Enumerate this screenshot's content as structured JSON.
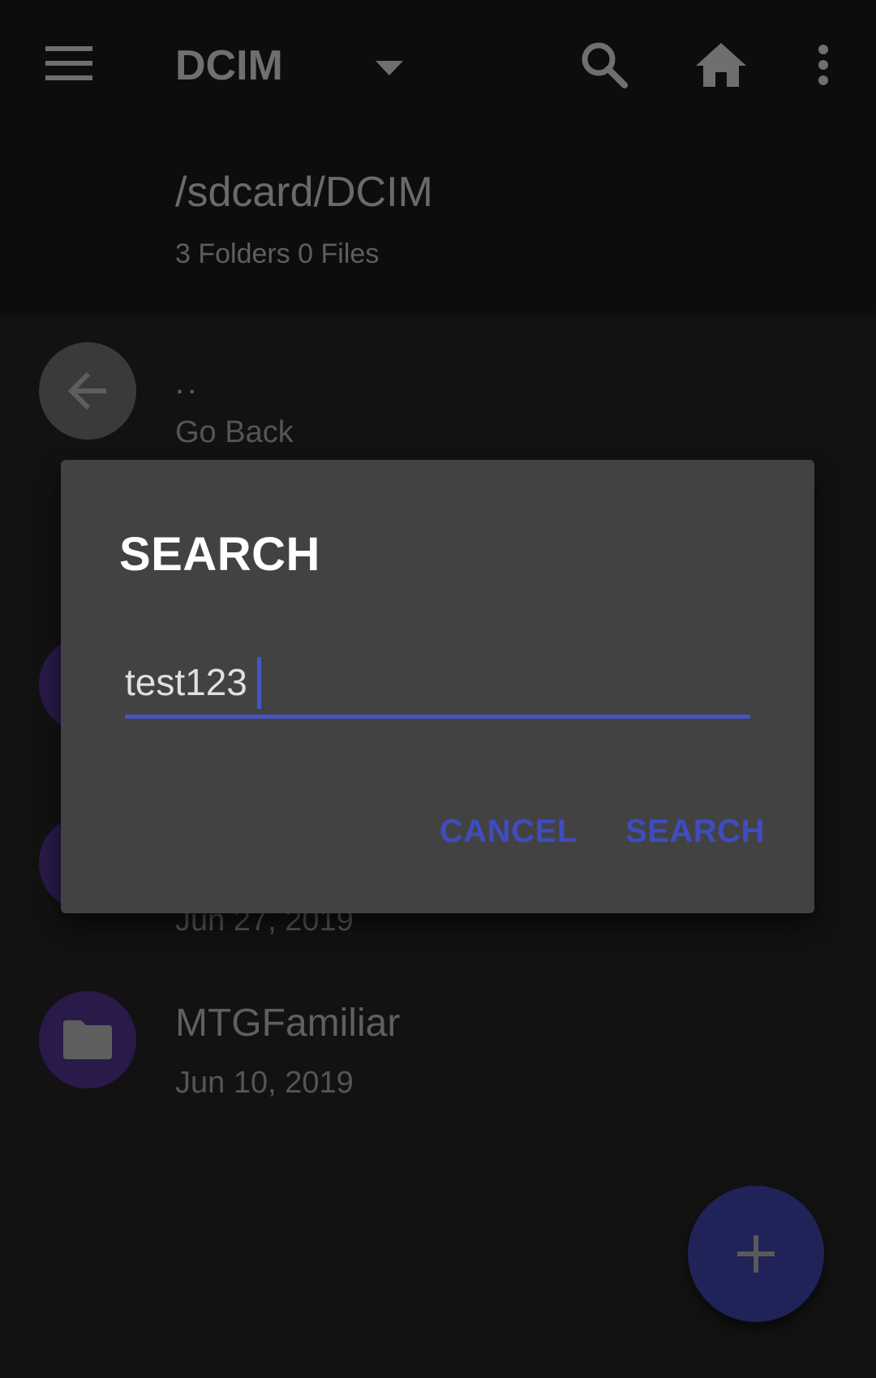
{
  "appbar": {
    "title": "DCIM",
    "path": "/sdcard/DCIM",
    "counts": "3 Folders 0 Files",
    "icons": {
      "menu": "menu-icon",
      "dropdown": "arrow-drop-down-icon",
      "search": "search-icon",
      "home": "home-icon",
      "overflow": "more-vert-icon"
    }
  },
  "list": {
    "back": {
      "name": "..",
      "sub": "Go Back",
      "icon": "arrow-back-icon"
    },
    "items": [
      {
        "name": "",
        "sub": "",
        "icon": "folder-icon"
      },
      {
        "name": "",
        "sub": "Jun 27, 2019",
        "icon": "folder-icon"
      },
      {
        "name": "MTGFamiliar",
        "sub": "Jun 10, 2019",
        "icon": "folder-icon"
      }
    ]
  },
  "dialog": {
    "title": "SEARCH",
    "input_value": "test123",
    "cancel_label": "CANCEL",
    "search_label": "SEARCH"
  },
  "fab": {
    "icon": "add-icon"
  },
  "colors": {
    "accent": "#3f4cc0",
    "folder_circle": "#2a1a4a",
    "dialog_bg": "#424242"
  }
}
